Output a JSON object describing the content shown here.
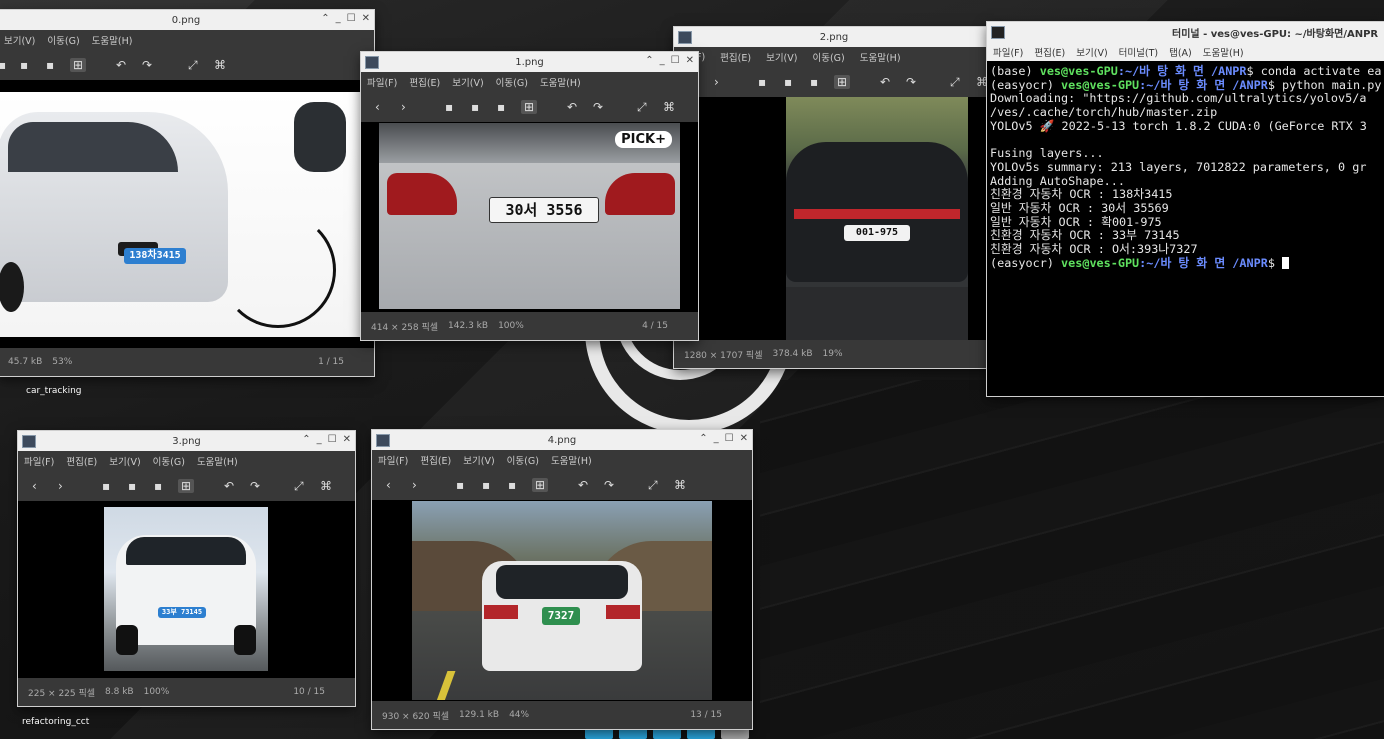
{
  "desktop": {
    "icons": [
      {
        "label": "car_tracking"
      },
      {
        "label": "refactoring_cct"
      }
    ]
  },
  "viewer_menu": [
    "파일(F)",
    "편집(E)",
    "보기(V)",
    "이동(G)",
    "도움말(H)"
  ],
  "viewer_menu_short": [
    "보기(V)",
    "이동(G)",
    "도움말(H)"
  ],
  "windows": {
    "w0": {
      "title": "0.png",
      "size": "45.7 kB",
      "zoom": "53%",
      "page": "1 / 15",
      "plate": "138차3415"
    },
    "w1": {
      "title": "1.png",
      "dims": "414 × 258 픽셀",
      "size": "142.3 kB",
      "zoom": "100%",
      "page": "4 / 15",
      "plate": "30서 3556",
      "badge": "PICK+"
    },
    "w2": {
      "title": "2.png",
      "menu_partial": [
        "F)",
        "편집(E)",
        "보기(V)",
        "이동(G)",
        "도움말(H)"
      ],
      "dims": "1280 × 1707 픽셀",
      "size": "378.4 kB",
      "zoom": "19%",
      "plate": "001-975"
    },
    "w3": {
      "title": "3.png",
      "dims": "225 × 225 픽셀",
      "size": "8.8 kB",
      "zoom": "100%",
      "page": "10 / 15",
      "plate": "33부 73145"
    },
    "w4": {
      "title": "4.png",
      "dims": "930 × 620 픽셀",
      "size": "129.1 kB",
      "zoom": "44%",
      "page": "13 / 15",
      "plate": "7327"
    }
  },
  "terminal": {
    "title": "터미널 - ves@ves-GPU: ~/바탕화면/ANPR",
    "menu": [
      "파일(F)",
      "편집(E)",
      "보기(V)",
      "터미널(T)",
      "탭(A)",
      "도움말(H)"
    ],
    "prompt_env1": "(base) ",
    "prompt_user": "ves@ves-GPU",
    "prompt_path": ":~/바 탕 화 면 /ANPR",
    "cmd1": "$ conda activate ea",
    "prompt_env2": "(easyocr) ",
    "cmd2": "$ python main.py",
    "lines": [
      "Downloading: \"https://github.com/ultralytics/yolov5/a",
      "/ves/.cache/torch/hub/master.zip",
      "YOLOv5 🚀 2022-5-13 torch 1.8.2 CUDA:0 (GeForce RTX 3",
      "",
      "Fusing layers...",
      "YOLOv5s summary: 213 layers, 7012822 parameters, 0 gr",
      "Adding AutoShape...",
      "친환경 자동차 OCR : 138차3415",
      "일반 자동차 OCR : 30서 35569",
      "일반 자동차 OCR : 확001-975",
      "친환경 자동차 OCR : 33부 73145",
      "친환경 자동차 OCR : O서:393나7327"
    ],
    "prompt_env3": "(easyocr) ",
    "cmd3": "$ "
  }
}
